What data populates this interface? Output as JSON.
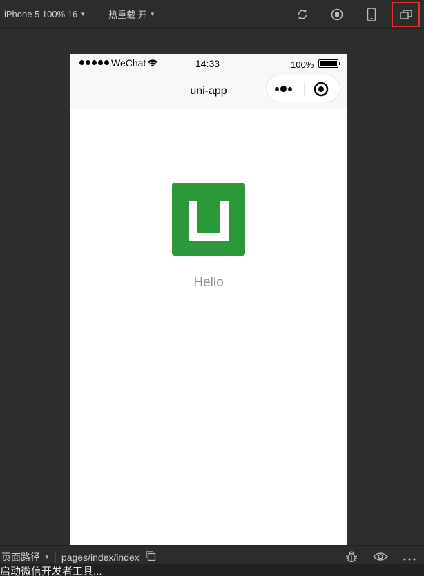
{
  "toolbar": {
    "device_select": "iPhone 5 100% 16",
    "hot_reload": "热重载 开",
    "icons": [
      "refresh-icon",
      "stop-icon",
      "phone-icon",
      "detach-window-icon"
    ]
  },
  "phone": {
    "status": {
      "carrier": "WeChat",
      "time": "14:33",
      "battery": "100%"
    },
    "nav": {
      "title": "uni-app"
    },
    "content": {
      "greeting": "Hello",
      "logo_color": "#2b9939"
    }
  },
  "bottombar": {
    "page_path_label": "页面路径",
    "page_path": "pages/index/index",
    "icons": [
      "copy-icon",
      "bug-icon",
      "eye-icon",
      "more-icon"
    ]
  },
  "overflow_text": "启动微信开发者工具..."
}
